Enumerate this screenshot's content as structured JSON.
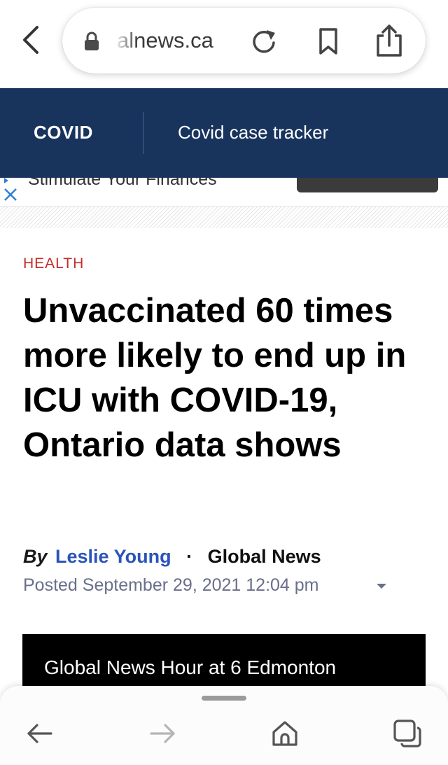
{
  "browser": {
    "url_text": "alnews.ca",
    "icons": {
      "back": "chevron-left-icon",
      "lock": "lock-icon",
      "reload": "reload-icon",
      "bookmark": "bookmark-icon",
      "share": "share-icon"
    }
  },
  "nav": {
    "items": [
      {
        "label": "COVID"
      },
      {
        "label": "Covid case tracker"
      }
    ],
    "background": "#18345d"
  },
  "ad": {
    "text": "Stimulate Your Finances",
    "icons": {
      "close": "close-icon",
      "adchoices": "play-icon"
    }
  },
  "article": {
    "category": "HEALTH",
    "headline": "Unvaccinated 60 times more likely to end up in ICU with COVID-19, Ontario data shows",
    "byline_prefix": "By",
    "author": "Leslie Young",
    "separator": "·",
    "publisher": "Global News",
    "posted": "Posted September 29, 2021 12:04 pm",
    "accent_color": "#c52a2a",
    "author_color": "#2a54b8"
  },
  "video": {
    "title": "Global News Hour at 6 Edmonton"
  },
  "toolbar": {
    "icons": [
      "back-arrow-icon",
      "forward-arrow-icon",
      "home-icon",
      "tabs-icon"
    ]
  }
}
